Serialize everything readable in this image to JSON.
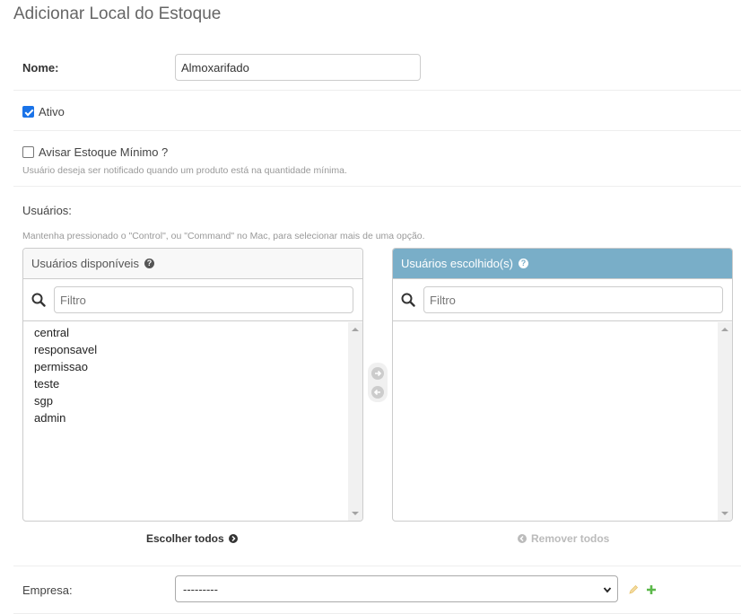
{
  "page": {
    "title": "Adicionar Local do Estoque"
  },
  "form": {
    "nome": {
      "label": "Nome:",
      "value": "Almoxarifado"
    },
    "ativo": {
      "label": "Ativo",
      "checked": true
    },
    "avisar": {
      "label": "Avisar Estoque Mínimo ?",
      "checked": false,
      "help": "Usuário deseja ser notificado quando um produto está na quantidade mínima."
    },
    "usuarios": {
      "label": "Usuários:",
      "help": "Mantenha pressionado o \"Control\", ou \"Command\" no Mac, para selecionar mais de uma opção.",
      "available": {
        "title": "Usuários disponíveis",
        "filter_placeholder": "Filtro",
        "items": [
          "central",
          "responsavel",
          "permissao",
          "teste",
          "sgp",
          "admin"
        ],
        "choose_all": "Escolher todos"
      },
      "chosen": {
        "title": "Usuários escolhido(s)",
        "filter_placeholder": "Filtro",
        "items": [],
        "remove_all": "Remover todos"
      }
    },
    "empresa": {
      "label": "Empresa:",
      "selected": "---------"
    }
  },
  "colors": {
    "chosen_header": "#79aec8",
    "checkbox": "#1a73e8",
    "add_icon": "#5bb84a",
    "edit_icon": "#e8c36b"
  },
  "icons": {
    "search": "search-icon",
    "help": "question-circle-icon",
    "choose": "arrow-right-circle-icon",
    "remove": "arrow-left-circle-icon",
    "edit": "pencil-icon",
    "add": "plus-icon"
  }
}
